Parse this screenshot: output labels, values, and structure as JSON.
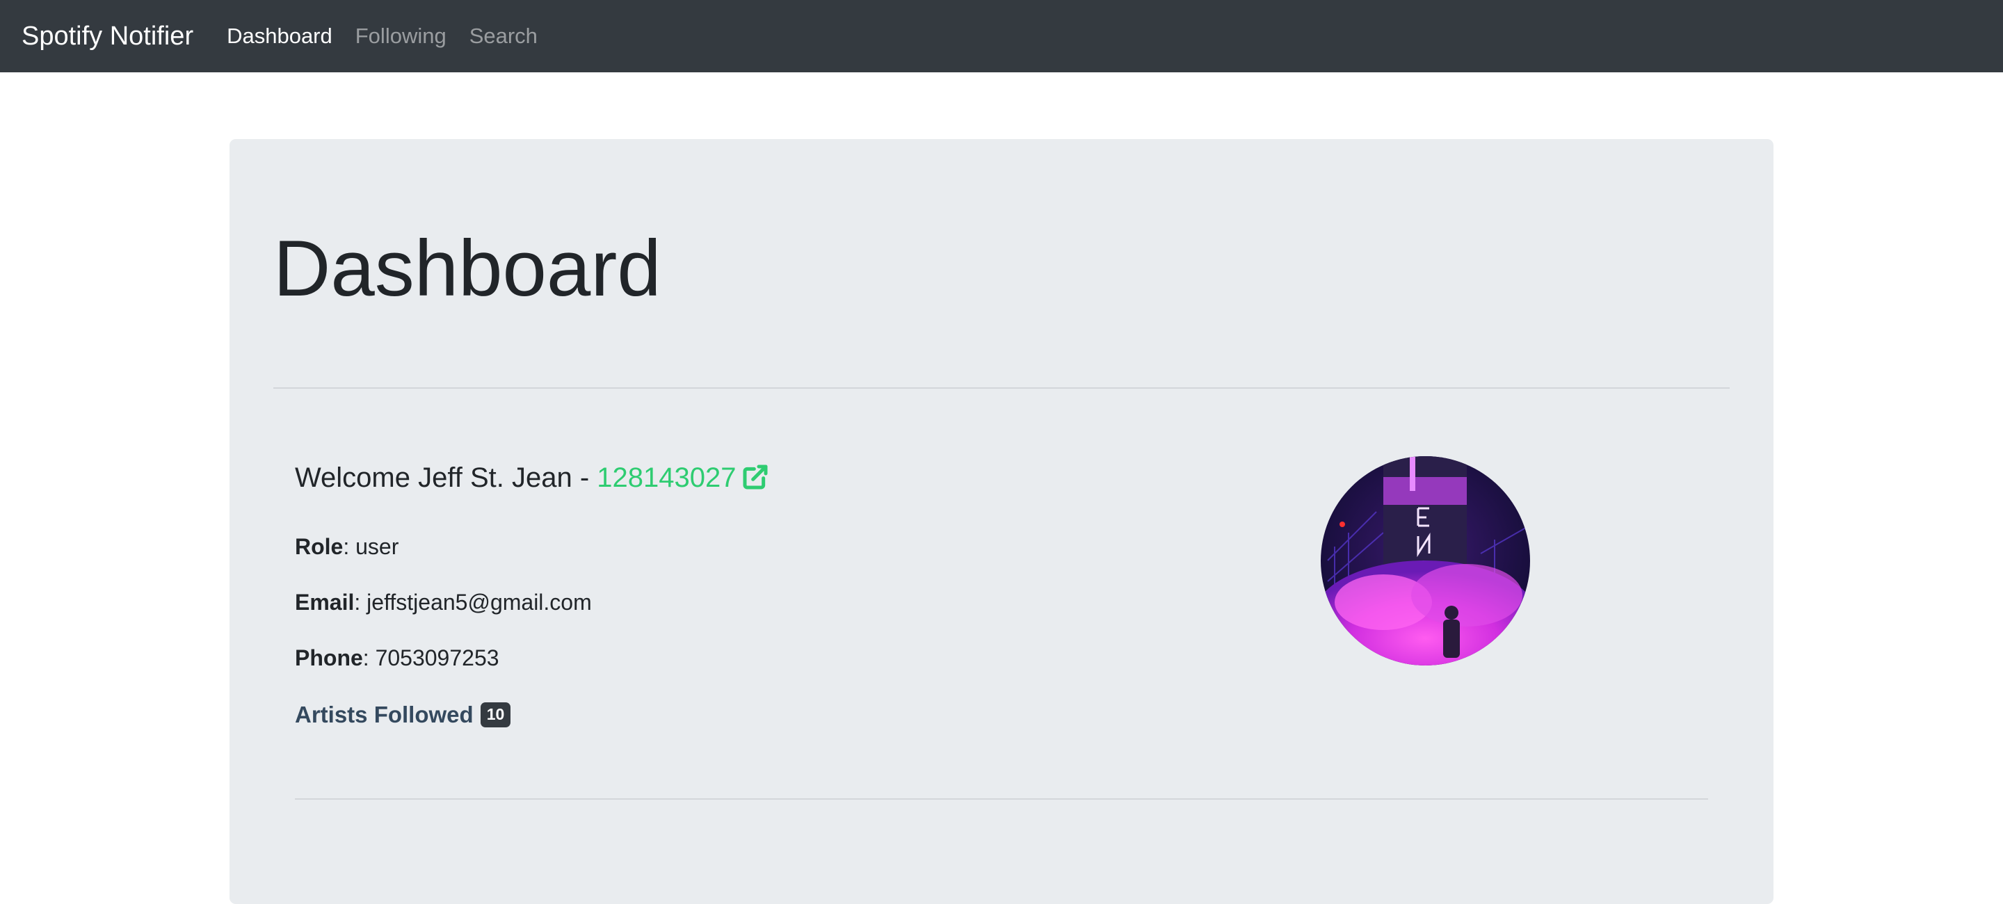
{
  "navbar": {
    "brand": "Spotify Notifier",
    "links": [
      {
        "label": "Dashboard",
        "active": true
      },
      {
        "label": "Following",
        "active": false
      },
      {
        "label": "Search",
        "active": false
      }
    ]
  },
  "dashboard": {
    "title": "Dashboard",
    "welcome_prefix": "Welcome Jeff St. Jean - ",
    "user_id": "128143027",
    "role_label": "Role",
    "role_value": ": user",
    "email_label": "Email",
    "email_value": ": jeffstjean5@gmail.com",
    "phone_label": "Phone",
    "phone_value": ": 7053097253",
    "artists_label": "Artists Followed",
    "artists_count": "10"
  },
  "colors": {
    "navbar_bg": "#343a40",
    "jumbotron_bg": "#e9ecef",
    "link_green": "#2ecc71",
    "artists_text": "#34495e",
    "badge_bg": "#343a40"
  },
  "icons": {
    "external_link": "external-link-icon"
  }
}
